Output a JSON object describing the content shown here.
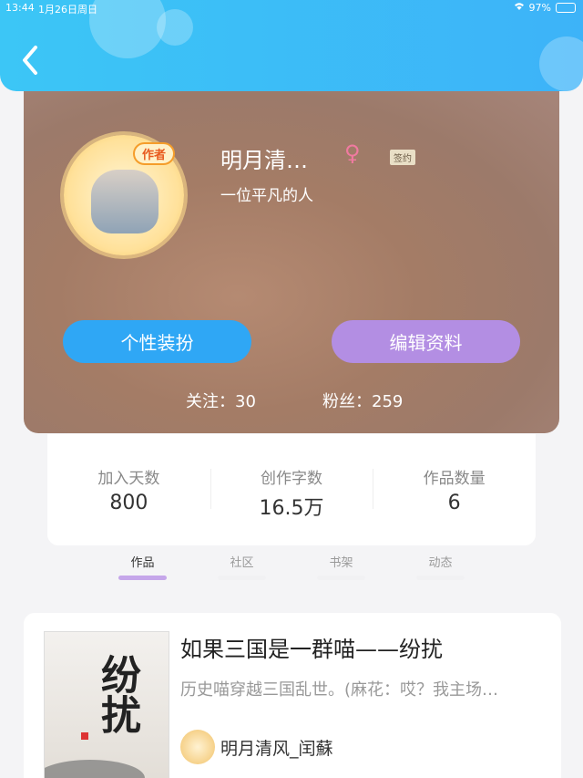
{
  "status": {
    "time": "13:44",
    "date": "1月26日周日",
    "battery": "97%",
    "battery_level": 0.97
  },
  "header": {
    "back_label": ""
  },
  "profile": {
    "avatar_badge": "作者",
    "name": "明月清…",
    "gender_symbol": "♀",
    "contract_tag": "签约",
    "bio": "一位平凡的人",
    "button_dress": "个性装扮",
    "button_edit": "编辑资料",
    "following": "关注：30",
    "fans": "粉丝：259"
  },
  "stats": [
    {
      "label": "加入天数",
      "value": "800"
    },
    {
      "label": "创作字数",
      "value": "16.5万"
    },
    {
      "label": "作品数量",
      "value": "6"
    }
  ],
  "tabs": [
    {
      "label": "作品",
      "active": true
    },
    {
      "label": "社区",
      "active": false
    },
    {
      "label": "书架",
      "active": false
    },
    {
      "label": "动态",
      "active": false
    }
  ],
  "work": {
    "cover_title": "纷扰",
    "title": "如果三国是一群喵——纷扰",
    "description": "历史喵穿越三国乱世。(麻花：哎？我主场…",
    "author": "明月清风_闰蘇"
  },
  "colors": {
    "header": "#3db3f8",
    "blue_button": "#2fa7f5",
    "purple_button": "#b38ee3",
    "active_tab": "#c5a6ea"
  }
}
